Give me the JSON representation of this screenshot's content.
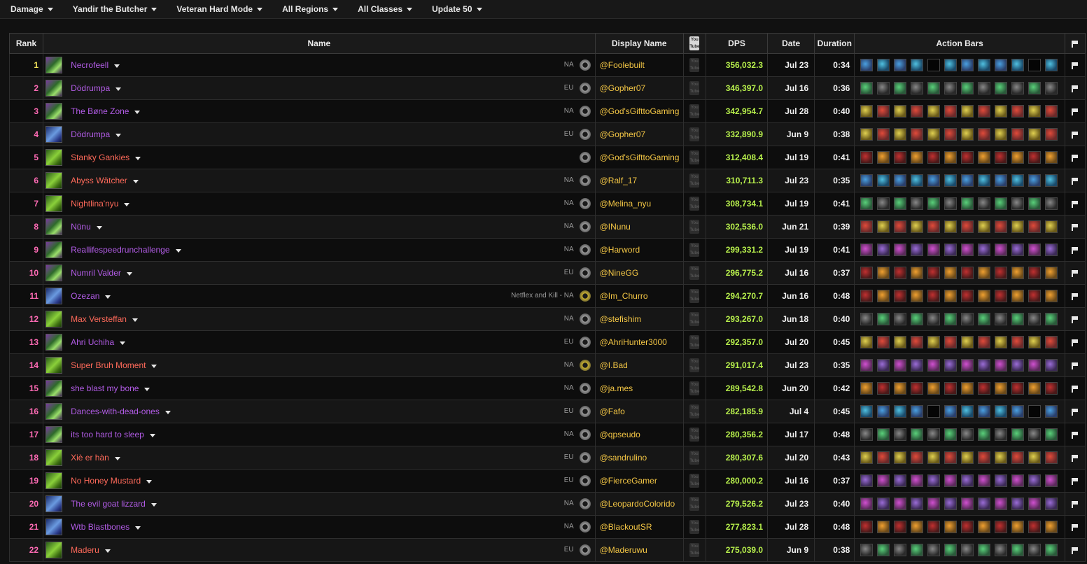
{
  "filters": [
    {
      "label": "Damage"
    },
    {
      "label": "Yandir the Butcher"
    },
    {
      "label": "Veteran Hard Mode"
    },
    {
      "label": "All Regions"
    },
    {
      "label": "All Classes"
    },
    {
      "label": "Update 50"
    }
  ],
  "headers": {
    "rank": "Rank",
    "name": "Name",
    "display_name": "Display Name",
    "youtube_icon": "youtube-icon",
    "dps": "DPS",
    "date": "Date",
    "duration": "Duration",
    "action_bars": "Action Bars",
    "flag_icon": "flag-icon"
  },
  "class_colors": {
    "necromancer": "#b25ce6",
    "warden": "#ff6a5a",
    "sorcerer": "#b25ce6"
  },
  "rows": [
    {
      "rank": "1",
      "name": "Necrofeell",
      "class": "necromancer",
      "region": "NA",
      "guild": "",
      "display_name": "@Foolebuilt",
      "dps": "356,032.3",
      "date": "Jul 23",
      "duration": "0:34"
    },
    {
      "rank": "2",
      "name": "Dödrumpa",
      "class": "necromancer",
      "region": "EU",
      "guild": "",
      "display_name": "@Gopher07",
      "dps": "346,397.0",
      "date": "Jul 16",
      "duration": "0:36"
    },
    {
      "rank": "3",
      "name": "The Bøne Zone",
      "class": "necromancer",
      "region": "NA",
      "guild": "",
      "display_name": "@God'sGifttoGaming",
      "dps": "342,954.7",
      "date": "Jul 28",
      "duration": "0:40"
    },
    {
      "rank": "4",
      "name": "Dödrumpa",
      "class": "sorcerer",
      "region": "EU",
      "guild": "",
      "display_name": "@Gopher07",
      "dps": "332,890.9",
      "date": "Jun 9",
      "duration": "0:38"
    },
    {
      "rank": "5",
      "name": "Stanky Gankies",
      "class": "warden",
      "region": "",
      "guild": "",
      "display_name": "@God'sGifttoGaming",
      "dps": "312,408.4",
      "date": "Jul 19",
      "duration": "0:41"
    },
    {
      "rank": "6",
      "name": "Abyss Wätcher",
      "class": "warden",
      "region": "NA",
      "guild": "",
      "display_name": "@Ralf_17",
      "dps": "310,711.3",
      "date": "Jul 23",
      "duration": "0:35"
    },
    {
      "rank": "7",
      "name": "Nightlina'nyu",
      "class": "warden",
      "region": "NA",
      "guild": "",
      "display_name": "@Melina_nyu",
      "dps": "308,734.1",
      "date": "Jul 19",
      "duration": "0:41"
    },
    {
      "rank": "8",
      "name": "Nūnu",
      "class": "necromancer",
      "region": "NA",
      "guild": "",
      "display_name": "@INunu",
      "dps": "302,536.0",
      "date": "Jun 21",
      "duration": "0:39"
    },
    {
      "rank": "9",
      "name": "Reallifespeedrunchallenge",
      "class": "necromancer",
      "region": "NA",
      "guild": "",
      "display_name": "@Harword",
      "dps": "299,331.2",
      "date": "Jul 19",
      "duration": "0:41"
    },
    {
      "rank": "10",
      "name": "Numril Valder",
      "class": "necromancer",
      "region": "EU",
      "guild": "",
      "display_name": "@NineGG",
      "dps": "296,775.2",
      "date": "Jul 16",
      "duration": "0:37"
    },
    {
      "rank": "11",
      "name": "Ozezan",
      "class": "sorcerer",
      "region": "NA",
      "guild": "Netflex and Kill - ",
      "display_name": "@Im_Churro",
      "dps": "294,270.7",
      "date": "Jun 16",
      "duration": "0:48"
    },
    {
      "rank": "12",
      "name": "Max Versteffan",
      "class": "warden",
      "region": "NA",
      "guild": "",
      "display_name": "@stefishim",
      "dps": "293,267.0",
      "date": "Jun 18",
      "duration": "0:40"
    },
    {
      "rank": "13",
      "name": "Ahri Uchiha",
      "class": "necromancer",
      "region": "EU",
      "guild": "",
      "display_name": "@AhriHunter3000",
      "dps": "292,357.0",
      "date": "Jul 20",
      "duration": "0:45"
    },
    {
      "rank": "14",
      "name": "Super Bruh Moment",
      "class": "warden",
      "region": "NA",
      "guild": "",
      "display_name": "@I.Bad",
      "dps": "291,017.4",
      "date": "Jul 23",
      "duration": "0:35"
    },
    {
      "rank": "15",
      "name": "she blast my bone",
      "class": "necromancer",
      "region": "NA",
      "guild": "",
      "display_name": "@ja.mes",
      "dps": "289,542.8",
      "date": "Jun 20",
      "duration": "0:42"
    },
    {
      "rank": "16",
      "name": "Dances-with-dead-ones",
      "class": "necromancer",
      "region": "EU",
      "guild": "",
      "display_name": "@Fafo",
      "dps": "282,185.9",
      "date": "Jul 4",
      "duration": "0:45"
    },
    {
      "rank": "17",
      "name": "its too hard to sleep",
      "class": "necromancer",
      "region": "NA",
      "guild": "",
      "display_name": "@qpseudo",
      "dps": "280,356.2",
      "date": "Jul 17",
      "duration": "0:48"
    },
    {
      "rank": "18",
      "name": "Xiè er hàn",
      "class": "warden",
      "region": "EU",
      "guild": "",
      "display_name": "@sandrulino",
      "dps": "280,307.6",
      "date": "Jul 20",
      "duration": "0:43"
    },
    {
      "rank": "19",
      "name": "No Honey Mustard",
      "class": "warden",
      "region": "EU",
      "guild": "",
      "display_name": "@FierceGamer",
      "dps": "280,000.2",
      "date": "Jul 16",
      "duration": "0:37"
    },
    {
      "rank": "20",
      "name": "The evil goat lizzard",
      "class": "sorcerer",
      "region": "NA",
      "guild": "",
      "display_name": "@LeopardoColorido",
      "dps": "279,526.2",
      "date": "Jul 23",
      "duration": "0:40"
    },
    {
      "rank": "21",
      "name": "Wtb Blastbones",
      "class": "sorcerer",
      "region": "NA",
      "guild": "",
      "display_name": "@BlackoutSR",
      "dps": "277,823.1",
      "date": "Jul 28",
      "duration": "0:48"
    },
    {
      "rank": "22",
      "name": "Maderu",
      "class": "warden",
      "region": "EU",
      "guild": "",
      "display_name": "@Maderuwu",
      "dps": "275,039.0",
      "date": "Jun 9",
      "duration": "0:38"
    }
  ]
}
